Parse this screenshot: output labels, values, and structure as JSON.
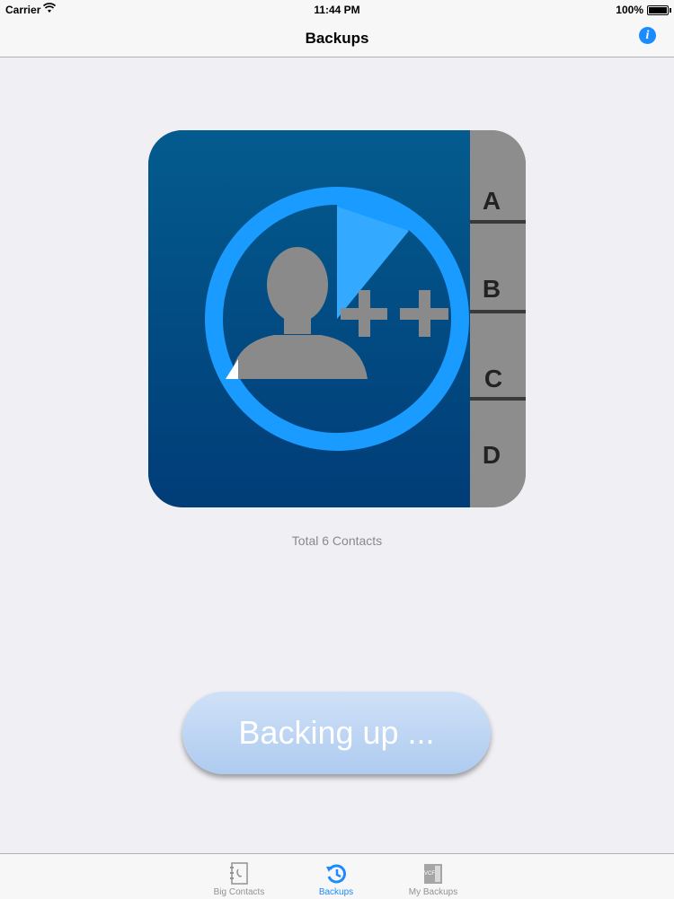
{
  "status_bar": {
    "carrier": "Carrier",
    "time": "11:44 PM",
    "battery": "100%"
  },
  "nav": {
    "title": "Backups",
    "info_icon": "info-icon"
  },
  "app_icon": {
    "tab_letters": [
      "A",
      "B",
      "C",
      "D"
    ],
    "plus_text": "++"
  },
  "total_text": "Total 6 Contacts",
  "backup_button": {
    "label": "Backing up ...",
    "color": "#bcd5f4"
  },
  "tabs": [
    {
      "label": "Big Contacts",
      "icon": "contacts-book-icon",
      "active": false
    },
    {
      "label": "Backups",
      "icon": "backup-history-icon",
      "active": true
    },
    {
      "label": "My Backups",
      "icon": "vcf-file-icon",
      "active": false
    }
  ],
  "colors": {
    "accent": "#1a8cff",
    "icon_blue_dark": "#003a73",
    "icon_ring": "#1a9bff"
  }
}
